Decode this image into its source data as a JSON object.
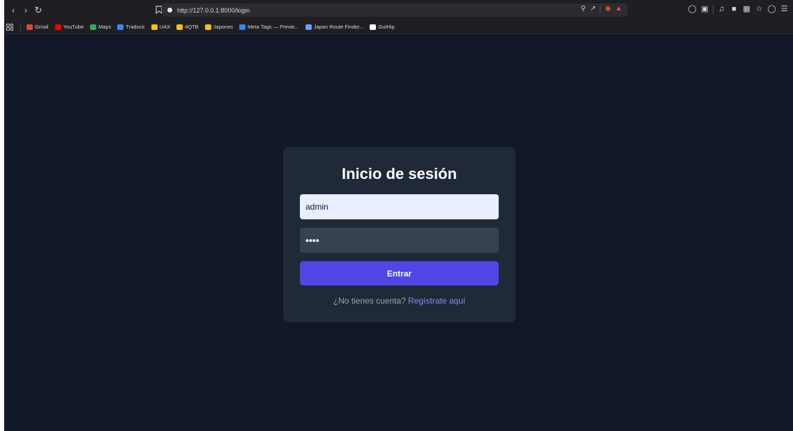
{
  "browser": {
    "url": "http://127.0.0.1:8000/login",
    "bookmarks": [
      {
        "label": "Gmail",
        "icon": "gmail-icon",
        "color": "#ea4335"
      },
      {
        "label": "YouTube",
        "icon": "youtube-icon",
        "color": "#ff0000"
      },
      {
        "label": "Maps",
        "icon": "maps-icon",
        "color": "#34a853"
      },
      {
        "label": "Traducir",
        "icon": "translate-icon",
        "color": "#4285f4"
      },
      {
        "label": "UAX",
        "icon": "folder-icon",
        "color": "#f4c20d"
      },
      {
        "label": "4QTB",
        "icon": "folder-icon",
        "color": "#f4c20d"
      },
      {
        "label": "Japones",
        "icon": "folder-icon",
        "color": "#f4c20d"
      },
      {
        "label": "Meta Tags — Previe...",
        "icon": "metatags-icon",
        "color": "#3b82f6"
      },
      {
        "label": "Japan Route Finder...",
        "icon": "route-icon",
        "color": "#60a5fa"
      },
      {
        "label": "GutHip",
        "icon": "github-icon",
        "color": "#ffffff"
      }
    ]
  },
  "login": {
    "title": "Inicio de sesión",
    "username_value": "admin",
    "password_value": "••••",
    "submit_label": "Entrar",
    "footer_text": "¿No tienes cuenta?",
    "register_link": "Regístrate aquí"
  },
  "colors": {
    "page_bg": "#111827",
    "card_bg": "#1f2937",
    "accent": "#4f46e5",
    "link": "#818cf8"
  }
}
